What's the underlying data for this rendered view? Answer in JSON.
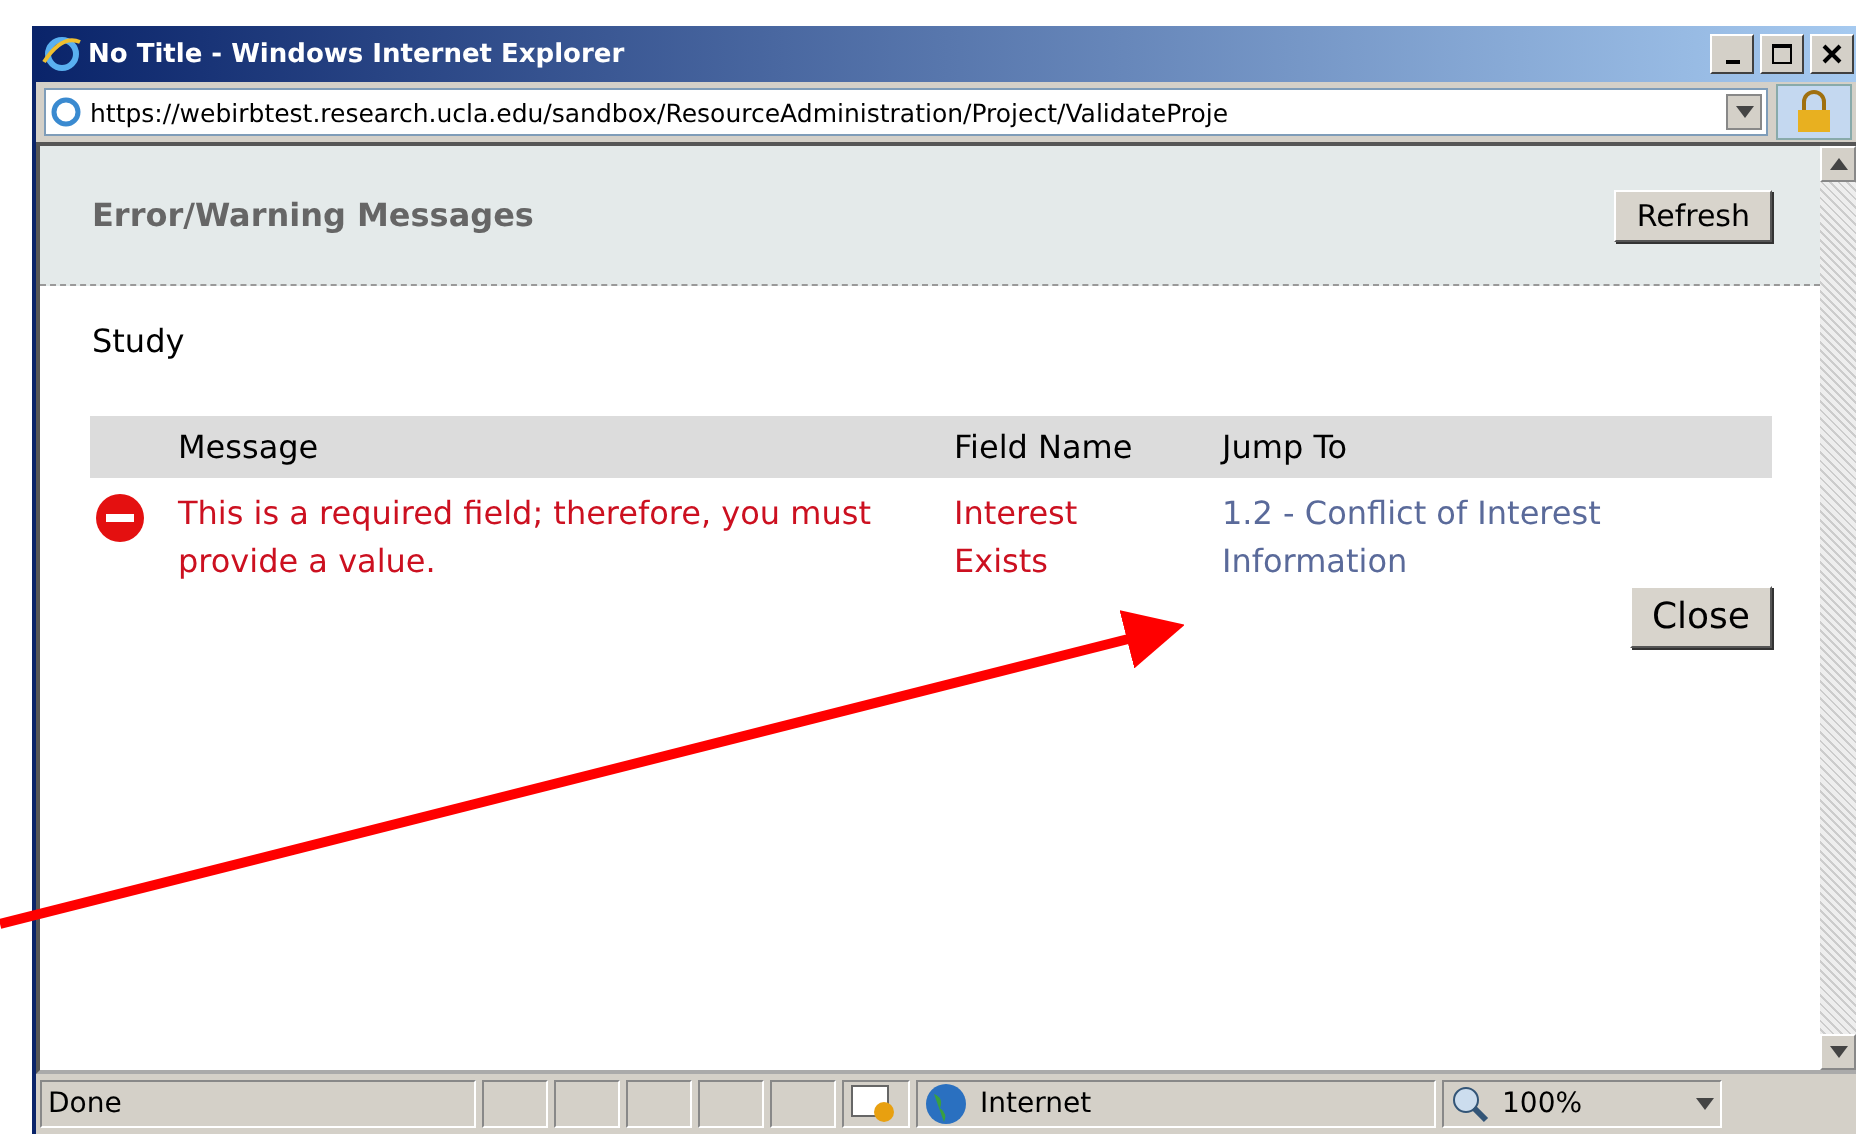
{
  "window": {
    "title": "No Title - Windows Internet Explorer"
  },
  "address_bar": {
    "url": "https://webirbtest.research.ucla.edu/sandbox/ResourceAdministration/Project/ValidateProje"
  },
  "panel": {
    "title": "Error/Warning Messages",
    "refresh_button": "Refresh",
    "section": "Study",
    "table": {
      "columns": [
        "Message",
        "Field Name",
        "Jump To"
      ],
      "rows": [
        {
          "kind": "error",
          "message": "This is a required field; therefore, you must provide a value.",
          "field_name": "Interest Exists",
          "jump_to": "1.2 - Conflict of Interest Information"
        }
      ]
    },
    "close_button": "Close"
  },
  "status_bar": {
    "status": "Done",
    "zone": "Internet",
    "zoom": "100%"
  }
}
